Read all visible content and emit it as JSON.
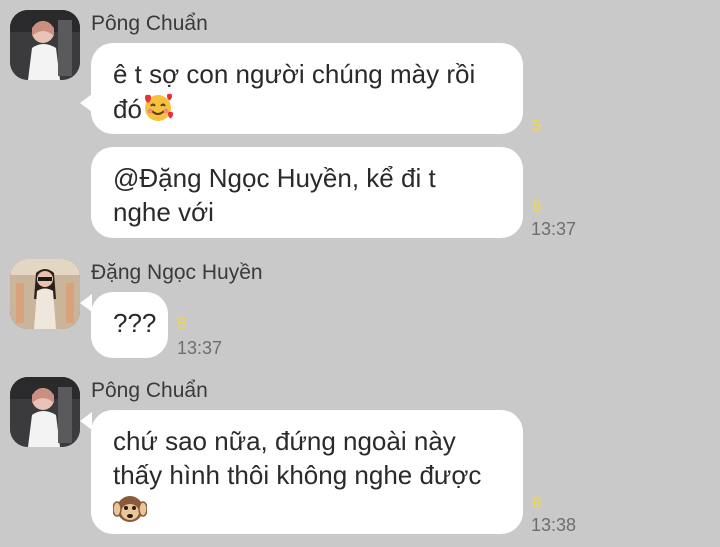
{
  "messages": [
    {
      "sender": "Pông Chuẩn",
      "avatar_icon": "girl-white-shirt-avatar",
      "bubbles": [
        {
          "line1": "ê t sợ con người chúng mày rồi",
          "line2": "đó",
          "emoji": "smiling-face-with-hearts",
          "count": "5",
          "time": ""
        },
        {
          "line1": "@Đặng Ngọc Huyền, kể đi t",
          "line2": "nghe với",
          "count": "5",
          "time": "13:37"
        }
      ]
    },
    {
      "sender": "Đặng Ngọc Huyền",
      "avatar_icon": "girl-sunglasses-avatar",
      "bubbles": [
        {
          "line1": "???",
          "count": "5",
          "time": "13:37"
        }
      ]
    },
    {
      "sender": "Pông Chuẩn",
      "avatar_icon": "girl-white-shirt-avatar",
      "bubbles": [
        {
          "line1": "chứ sao nữa, đứng ngoài này",
          "line2": "thấy hình thôi không nghe được",
          "emoji": "hear-no-evil-monkey",
          "count": "6",
          "time": "13:38"
        }
      ]
    }
  ]
}
